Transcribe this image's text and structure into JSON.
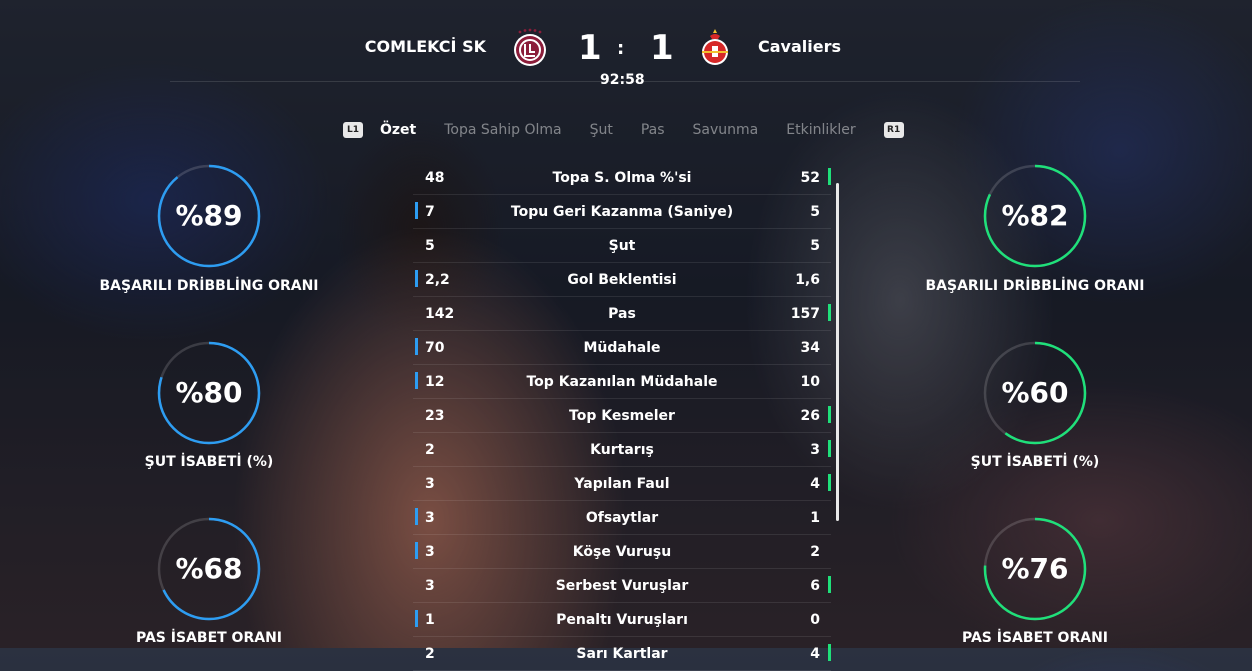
{
  "header": {
    "home_team": "COMLEKCİ SK",
    "away_team": "Cavaliers",
    "home_score": "1",
    "separator": ":",
    "away_score": "1",
    "clock": "92:58"
  },
  "tabs": {
    "left_hint": "L1",
    "right_hint": "R1",
    "items": [
      "Özet",
      "Topa Sahip Olma",
      "Şut",
      "Pas",
      "Savunma",
      "Etkinlikler"
    ],
    "active_index": 0
  },
  "colors": {
    "home_accent": "#2d9df2",
    "away_accent": "#1fe07a",
    "home_crest": "#8b1d3a",
    "away_crest": "#d62828"
  },
  "home_gauges": [
    {
      "pct_text": "%89",
      "value": 89,
      "label": "BAŞARILI DRİBBLİNG ORANI"
    },
    {
      "pct_text": "%80",
      "value": 80,
      "label": "ŞUT İSABETİ (%)"
    },
    {
      "pct_text": "%68",
      "value": 68,
      "label": "PAS İSABET ORANI"
    }
  ],
  "away_gauges": [
    {
      "pct_text": "%82",
      "value": 82,
      "label": "BAŞARILI DRİBBLİNG ORANI"
    },
    {
      "pct_text": "%60",
      "value": 60,
      "label": "ŞUT İSABETİ (%)"
    },
    {
      "pct_text": "%76",
      "value": 76,
      "label": "PAS İSABET ORANI"
    }
  ],
  "stats": [
    {
      "home": "48",
      "label": "Topa S. Olma %'si",
      "away": "52",
      "lead": "away"
    },
    {
      "home": "7",
      "label": "Topu Geri Kazanma (Saniye)",
      "away": "5",
      "lead": "home"
    },
    {
      "home": "5",
      "label": "Şut",
      "away": "5",
      "lead": "none"
    },
    {
      "home": "2,2",
      "label": "Gol Beklentisi",
      "away": "1,6",
      "lead": "home"
    },
    {
      "home": "142",
      "label": "Pas",
      "away": "157",
      "lead": "away"
    },
    {
      "home": "70",
      "label": "Müdahale",
      "away": "34",
      "lead": "home"
    },
    {
      "home": "12",
      "label": "Top Kazanılan Müdahale",
      "away": "10",
      "lead": "home"
    },
    {
      "home": "23",
      "label": "Top Kesmeler",
      "away": "26",
      "lead": "away"
    },
    {
      "home": "2",
      "label": "Kurtarış",
      "away": "3",
      "lead": "away"
    },
    {
      "home": "3",
      "label": "Yapılan Faul",
      "away": "4",
      "lead": "away"
    },
    {
      "home": "3",
      "label": "Ofsaytlar",
      "away": "1",
      "lead": "home"
    },
    {
      "home": "3",
      "label": "Köşe Vuruşu",
      "away": "2",
      "lead": "home"
    },
    {
      "home": "3",
      "label": "Serbest Vuruşlar",
      "away": "6",
      "lead": "away"
    },
    {
      "home": "1",
      "label": "Penaltı Vuruşları",
      "away": "0",
      "lead": "home"
    },
    {
      "home": "2",
      "label": "Sarı Kartlar",
      "away": "4",
      "lead": "away"
    }
  ]
}
